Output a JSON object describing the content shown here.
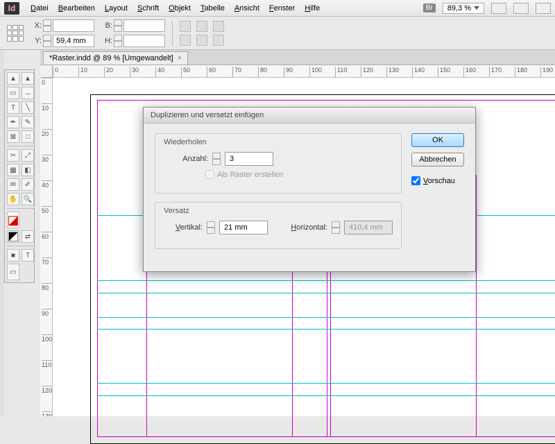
{
  "app": {
    "logo": "Id"
  },
  "menu": {
    "datei": "Datei",
    "bearbeiten": "Bearbeiten",
    "layout": "Layout",
    "schrift": "Schrift",
    "objekt": "Objekt",
    "tabelle": "Tabelle",
    "ansicht": "Ansicht",
    "fenster": "Fenster",
    "hilfe": "Hilfe",
    "br": "Br",
    "zoom": "89,3 %"
  },
  "control": {
    "x_label": "X:",
    "x_value": "",
    "y_label": "Y:",
    "y_value": "59,4 mm",
    "w_label": "B:",
    "w_value": "",
    "h_label": "H:",
    "h_value": ""
  },
  "doc_tab": {
    "title": "*Raster.indd @ 89 % [Umgewandelt]",
    "close": "×"
  },
  "ruler_h": [
    "0",
    "10",
    "20",
    "30",
    "40",
    "50",
    "60",
    "70",
    "80",
    "90",
    "100",
    "110",
    "120",
    "130",
    "140",
    "150",
    "160",
    "170",
    "180",
    "190"
  ],
  "ruler_v": [
    "0",
    "10",
    "20",
    "30",
    "40",
    "50",
    "60",
    "70",
    "80",
    "90",
    "100",
    "110",
    "120",
    "130"
  ],
  "dialog": {
    "title": "Duplizieren und versetzt einfügen",
    "group_repeat": "Wiederholen",
    "count_label": "Anzahl:",
    "count_value": "3",
    "as_grid": "Als Raster erstellen",
    "group_offset": "Versatz",
    "vertical_label": "Vertikal:",
    "vertical_value": "21 mm",
    "horizontal_label": "Horizontal:",
    "horizontal_value": "410,4 mm",
    "ok": "OK",
    "cancel": "Abbrechen",
    "preview": "Vorschau"
  }
}
